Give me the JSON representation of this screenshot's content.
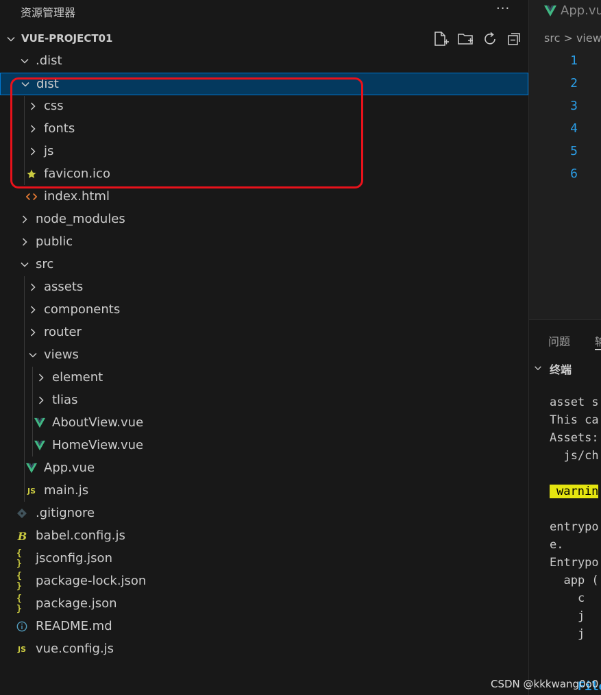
{
  "explorer": {
    "title": "资源管理器",
    "more": "···",
    "project": "VUE-PROJECT01",
    "actions": [
      "new-file-icon",
      "new-folder-icon",
      "refresh-icon",
      "collapse-all-icon"
    ]
  },
  "tree": [
    {
      "label": ".dist",
      "icon": "chevron-down-icon",
      "expanded": true
    },
    {
      "label": "dist",
      "icon": "chevron-down-icon",
      "expanded": true,
      "selected": true
    },
    {
      "label": "css",
      "icon": "chevron-right-icon"
    },
    {
      "label": "fonts",
      "icon": "chevron-right-icon"
    },
    {
      "label": "js",
      "icon": "chevron-right-icon"
    },
    {
      "label": "favicon.ico",
      "icon": "star-icon"
    },
    {
      "label": "index.html",
      "icon": "html-icon"
    },
    {
      "label": "node_modules",
      "icon": "chevron-right-icon"
    },
    {
      "label": "public",
      "icon": "chevron-right-icon"
    },
    {
      "label": "src",
      "icon": "chevron-down-icon",
      "expanded": true
    },
    {
      "label": "assets",
      "icon": "chevron-right-icon"
    },
    {
      "label": "components",
      "icon": "chevron-right-icon"
    },
    {
      "label": "router",
      "icon": "chevron-right-icon"
    },
    {
      "label": "views",
      "icon": "chevron-down-icon",
      "expanded": true
    },
    {
      "label": "element",
      "icon": "chevron-right-icon"
    },
    {
      "label": "tlias",
      "icon": "chevron-right-icon"
    },
    {
      "label": "AboutView.vue",
      "icon": "vue-icon"
    },
    {
      "label": "HomeView.vue",
      "icon": "vue-icon"
    },
    {
      "label": "App.vue",
      "icon": "vue-icon"
    },
    {
      "label": "main.js",
      "icon": "js-icon",
      "icon_text": "JS"
    },
    {
      "label": ".gitignore",
      "icon": "git-icon"
    },
    {
      "label": "babel.config.js",
      "icon": "babel-icon"
    },
    {
      "label": "jsconfig.json",
      "icon": "json-icon",
      "icon_text": "{ }"
    },
    {
      "label": "package-lock.json",
      "icon": "json-icon",
      "icon_text": "{ }"
    },
    {
      "label": "package.json",
      "icon": "json-icon",
      "icon_text": "{ }"
    },
    {
      "label": "README.md",
      "icon": "info-icon"
    },
    {
      "label": "vue.config.js",
      "icon": "js-icon",
      "icon_text": "JS"
    }
  ],
  "editor": {
    "tab_label": "App.vu",
    "breadcrumb": "src > view",
    "line_numbers": [
      "1",
      "2",
      "3",
      "4",
      "5",
      "6"
    ]
  },
  "panel": {
    "tabs": [
      "问题",
      "输"
    ],
    "terminal_title": "终端",
    "lines": [
      "asset s",
      "This ca",
      "Assets:",
      "  js/ch",
      "",
      "warnin",
      "",
      "entrypo",
      "e.",
      "Entrypo",
      "  app (",
      "    c",
      "    j",
      "    j",
      "",
      "",
      "    File"
    ]
  },
  "watermark": "CSDN @kkkwang0o0",
  "colors": {
    "accent": "#0078d4",
    "selection": "#04395e",
    "callout": "#e8121b",
    "vue": "#41b883",
    "js": "#cbcb41",
    "html": "#e37933",
    "terminal_warning": "#e5e510"
  }
}
